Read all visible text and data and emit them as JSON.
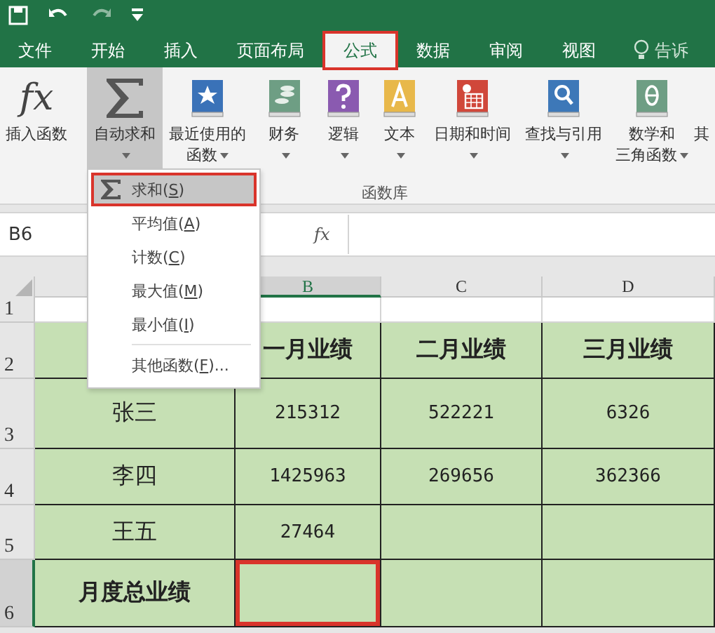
{
  "tabs": [
    {
      "label": "文件",
      "selected": false,
      "annotated": false
    },
    {
      "label": "开始",
      "selected": false,
      "annotated": false
    },
    {
      "label": "插入",
      "selected": false,
      "annotated": false
    },
    {
      "label": "页面布局",
      "selected": false,
      "annotated": false
    },
    {
      "label": "公式",
      "selected": true,
      "annotated": true
    },
    {
      "label": "数据",
      "selected": false,
      "annotated": false
    },
    {
      "label": "审阅",
      "selected": false,
      "annotated": false
    },
    {
      "label": "视图",
      "selected": false,
      "annotated": false
    }
  ],
  "tell_me": "告诉",
  "ribbon": {
    "group_label": "函数库",
    "buttons": [
      {
        "kind": "fx",
        "icon_text": "fx",
        "label": "插入函数",
        "dropdown": false,
        "selected": false
      },
      {
        "kind": "sigma",
        "label": "自动求和",
        "dropdown": true,
        "selected": true
      },
      {
        "kind": "recent",
        "label": "最近使用的",
        "label_2": "函数",
        "dropdown": true,
        "selected": false
      },
      {
        "kind": "finance",
        "label": "财务",
        "dropdown": true,
        "selected": false
      },
      {
        "kind": "logic",
        "label": "逻辑",
        "dropdown": true,
        "selected": false
      },
      {
        "kind": "text",
        "label": "文本",
        "dropdown": true,
        "selected": false
      },
      {
        "kind": "date",
        "label": "日期和时间",
        "dropdown": true,
        "selected": false
      },
      {
        "kind": "lookup",
        "label": "查找与引用",
        "dropdown": true,
        "selected": false
      },
      {
        "kind": "math",
        "label": "数学和",
        "label_2": "三角函数",
        "dropdown": true,
        "selected": false
      },
      {
        "kind": "more",
        "label": "其",
        "dropdown": false,
        "selected": false
      }
    ]
  },
  "menu": {
    "items": [
      {
        "icon": true,
        "before": "求和(",
        "accel": "S",
        "after": ")",
        "selected": true,
        "annotated": true
      },
      {
        "icon": false,
        "before": "平均值(",
        "accel": "A",
        "after": ")",
        "selected": false,
        "annotated": false
      },
      {
        "icon": false,
        "before": "计数(",
        "accel": "C",
        "after": ")",
        "selected": false,
        "annotated": false
      },
      {
        "icon": false,
        "before": "最大值(",
        "accel": "M",
        "after": ")",
        "selected": false,
        "annotated": false
      },
      {
        "icon": false,
        "before": "最小值(",
        "accel": "I",
        "after": ")",
        "selected": false,
        "annotated": false
      },
      {
        "icon": false,
        "before": "其他函数(",
        "accel": "F",
        "after": ")...",
        "selected": false,
        "annotated": false,
        "separator_before": true
      }
    ]
  },
  "formula_bar": {
    "name_box": "B6",
    "fx": "fx"
  },
  "sheet": {
    "columns": [
      {
        "selected": false
      },
      {
        "label": "B",
        "selected": true
      },
      {
        "label": "C",
        "selected": false
      },
      {
        "label": "D",
        "selected": false
      }
    ],
    "rows": [
      {
        "number": "1",
        "shaded": false,
        "selected": false,
        "cells": []
      },
      {
        "number": "2",
        "shaded": true,
        "selected": false,
        "cells": [
          {},
          {
            "text": "一月业绩",
            "bold": true
          },
          {
            "text": "二月业绩",
            "bold": true
          },
          {
            "text": "三月业绩",
            "bold": true
          }
        ]
      },
      {
        "number": "3",
        "shaded": true,
        "selected": false,
        "cells": [
          {
            "text": "张三"
          },
          {
            "text": "215312",
            "numeric": true
          },
          {
            "text": "522221",
            "numeric": true
          },
          {
            "text": "6326",
            "numeric": true
          }
        ]
      },
      {
        "number": "4",
        "shaded": true,
        "selected": false,
        "cells": [
          {
            "text": "李四"
          },
          {
            "text": "1425963",
            "numeric": true
          },
          {
            "text": "269656",
            "numeric": true
          },
          {
            "text": "362366",
            "numeric": true
          }
        ]
      },
      {
        "number": "5",
        "shaded": true,
        "selected": false,
        "cells": [
          {
            "text": "王五"
          },
          {
            "text": "27464",
            "numeric": true
          }
        ]
      },
      {
        "number": "6",
        "shaded": true,
        "selected": true,
        "cells": [
          {
            "text": "月度总业绩",
            "bold": true
          },
          {
            "annotated": true
          }
        ]
      }
    ]
  }
}
